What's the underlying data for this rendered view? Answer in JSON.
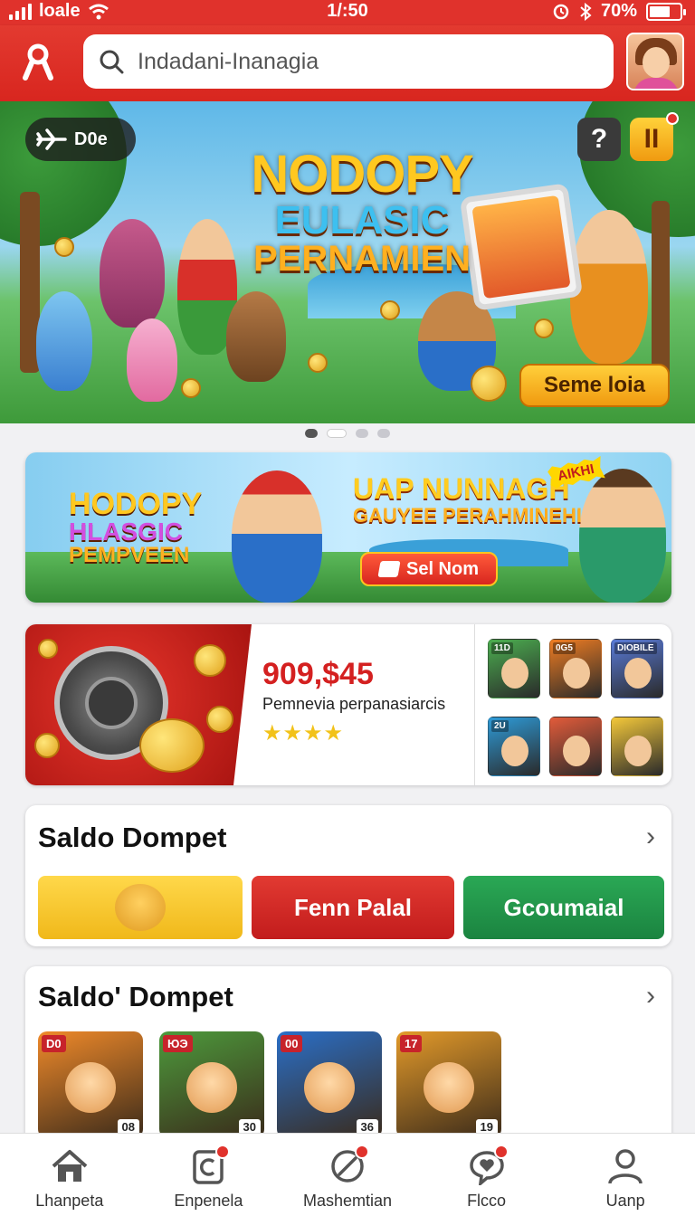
{
  "status": {
    "carrier": "loale",
    "time": "1/:50",
    "battery": "70%",
    "battery_level": 0.7
  },
  "header": {
    "search_placeholder": "Indadani-Inanagia"
  },
  "hero": {
    "pill_label": "D0e",
    "help_symbol": "?",
    "pause_symbol": "II",
    "title_lines": [
      "NODOPY",
      "EULASIC",
      "PERNAMIEN"
    ],
    "cta_label": "Seme loia",
    "slides": 4,
    "active_slide": 2
  },
  "banner2": {
    "logo_lines": [
      "HODOPY",
      "HLASGIC",
      "PEMPVEEN"
    ],
    "heading": "UAP NUNNAGH",
    "subheading": "GAUYEE PERAHMINEHI",
    "badge": "AIKHI",
    "button_label": "Sel Nom"
  },
  "jackpot": {
    "amount": "909,$45",
    "description": "Pemnevia perpanasiarcis",
    "stars": "★★★★",
    "tiles": [
      {
        "tag": "11D",
        "color": "#4caf50"
      },
      {
        "tag": "0G5",
        "color": "#f07d22"
      },
      {
        "tag": "DIOBILE",
        "color": "#5a7bd8"
      },
      {
        "tag": "2U",
        "color": "#2e9bd8"
      },
      {
        "tag": "",
        "color": "#e25b3a"
      },
      {
        "tag": "",
        "color": "#f4c83a"
      }
    ]
  },
  "wallet": {
    "title": "Saldo Dompet",
    "chevron": "›",
    "buttons": [
      {
        "label": "",
        "color": "#f6c62a"
      },
      {
        "label": "Fenn Palal",
        "color": "#d42626"
      },
      {
        "label": "Gcoumaial",
        "color": "#21944a"
      }
    ]
  },
  "games_section": {
    "title": "Saldo' Dompet",
    "chevron": "›",
    "games": [
      {
        "tag": "D0",
        "num": "08",
        "bg": "#f08a2a"
      },
      {
        "tag": "ЮЭ",
        "num": "30",
        "bg": "#4d9a3c"
      },
      {
        "tag": "00",
        "num": "36",
        "bg": "#2a6fc8"
      },
      {
        "tag": "17",
        "num": "19",
        "bg": "#e39a2a"
      }
    ]
  },
  "nav": [
    {
      "label": "Lhanpeta",
      "icon": "home-icon",
      "badge": false
    },
    {
      "label": "Enpenela",
      "icon": "clipboard-icon",
      "badge": true
    },
    {
      "label": "Mashemtian",
      "icon": "compass-icon",
      "badge": true
    },
    {
      "label": "Flcco",
      "icon": "heart-chat-icon",
      "badge": true
    },
    {
      "label": "Uanp",
      "icon": "profile-icon",
      "badge": false
    }
  ]
}
